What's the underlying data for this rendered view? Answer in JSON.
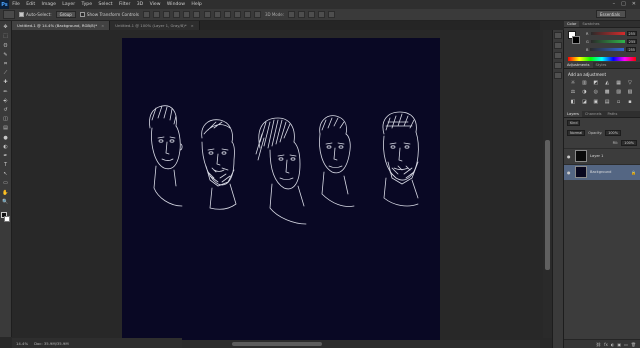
{
  "app": {
    "logo": "Ps"
  },
  "menu": [
    "File",
    "Edit",
    "Image",
    "Layer",
    "Type",
    "Select",
    "Filter",
    "3D",
    "View",
    "Window",
    "Help"
  ],
  "window_controls": [
    "–",
    "□",
    "✕"
  ],
  "options_bar": {
    "auto_select_label": "Auto-Select:",
    "auto_select_target": "Group",
    "show_transform_label": "Show Transform Controls",
    "mode_3d_label": "3D Mode:",
    "workspace": "Essentials"
  },
  "tabs": [
    {
      "label": "Untitled-1 @ 14.4% (Background, RGB/8)*",
      "active": true
    },
    {
      "label": "Untitled-1 @ 100% (Layer 1, Gray/8)*",
      "active": false
    }
  ],
  "tools": [
    "move-icon",
    "marquee-icon",
    "lasso-icon",
    "quick-select-icon",
    "crop-icon",
    "eyedropper-icon",
    "healing-icon",
    "brush-icon",
    "clone-stamp-icon",
    "history-brush-icon",
    "eraser-icon",
    "gradient-icon",
    "blur-icon",
    "dodge-icon",
    "pen-icon",
    "type-icon",
    "path-select-icon",
    "shape-icon",
    "hand-icon",
    "zoom-icon"
  ],
  "tool_glyphs": [
    "✥",
    "⬚",
    "ʘ",
    "✎",
    "⌗",
    "⟋",
    "✚",
    "✏",
    "⎆",
    "↺",
    "◫",
    "▤",
    "●",
    "◐",
    "✒",
    "T",
    "↖",
    "▭",
    "✋",
    "🔍"
  ],
  "status": {
    "zoom": "14.4%",
    "doc": "Doc: 35.9M/35.9M"
  },
  "color_panel": {
    "tabs": [
      "Color",
      "Swatches"
    ],
    "sliders": [
      {
        "label": "R",
        "value": "255",
        "color": "#d62b2b"
      },
      {
        "label": "G",
        "value": "255",
        "color": "#2fb54a"
      },
      {
        "label": "B",
        "value": "255",
        "color": "#3267d6"
      }
    ]
  },
  "adjustments_panel": {
    "tabs": [
      "Adjustments",
      "Styles"
    ],
    "title": "Add an adjustment",
    "icons": [
      "☼",
      "▥",
      "◩",
      "◭",
      "▦",
      "▽",
      "⚖",
      "◑",
      "◎",
      "▩",
      "▨",
      "▧",
      "◧",
      "◪",
      "▣",
      "▤",
      "▫",
      "▪"
    ]
  },
  "layers_panel": {
    "tabs": [
      "Layers",
      "Channels",
      "Paths"
    ],
    "kind": "Kind",
    "blend": "Normal",
    "opacity_label": "Opacity:",
    "opacity": "100%",
    "fill_label": "Fill:",
    "fill": "100%",
    "layers": [
      {
        "name": "Layer 1",
        "selected": false
      },
      {
        "name": "Background",
        "selected": true
      }
    ],
    "footer_icons": [
      "⛓",
      "fx",
      "◐",
      "▣",
      "▭",
      "🗑"
    ]
  },
  "colors": {
    "artboard": "#090824",
    "line_art": "#d9dbe6",
    "selected_layer": "#546683"
  }
}
